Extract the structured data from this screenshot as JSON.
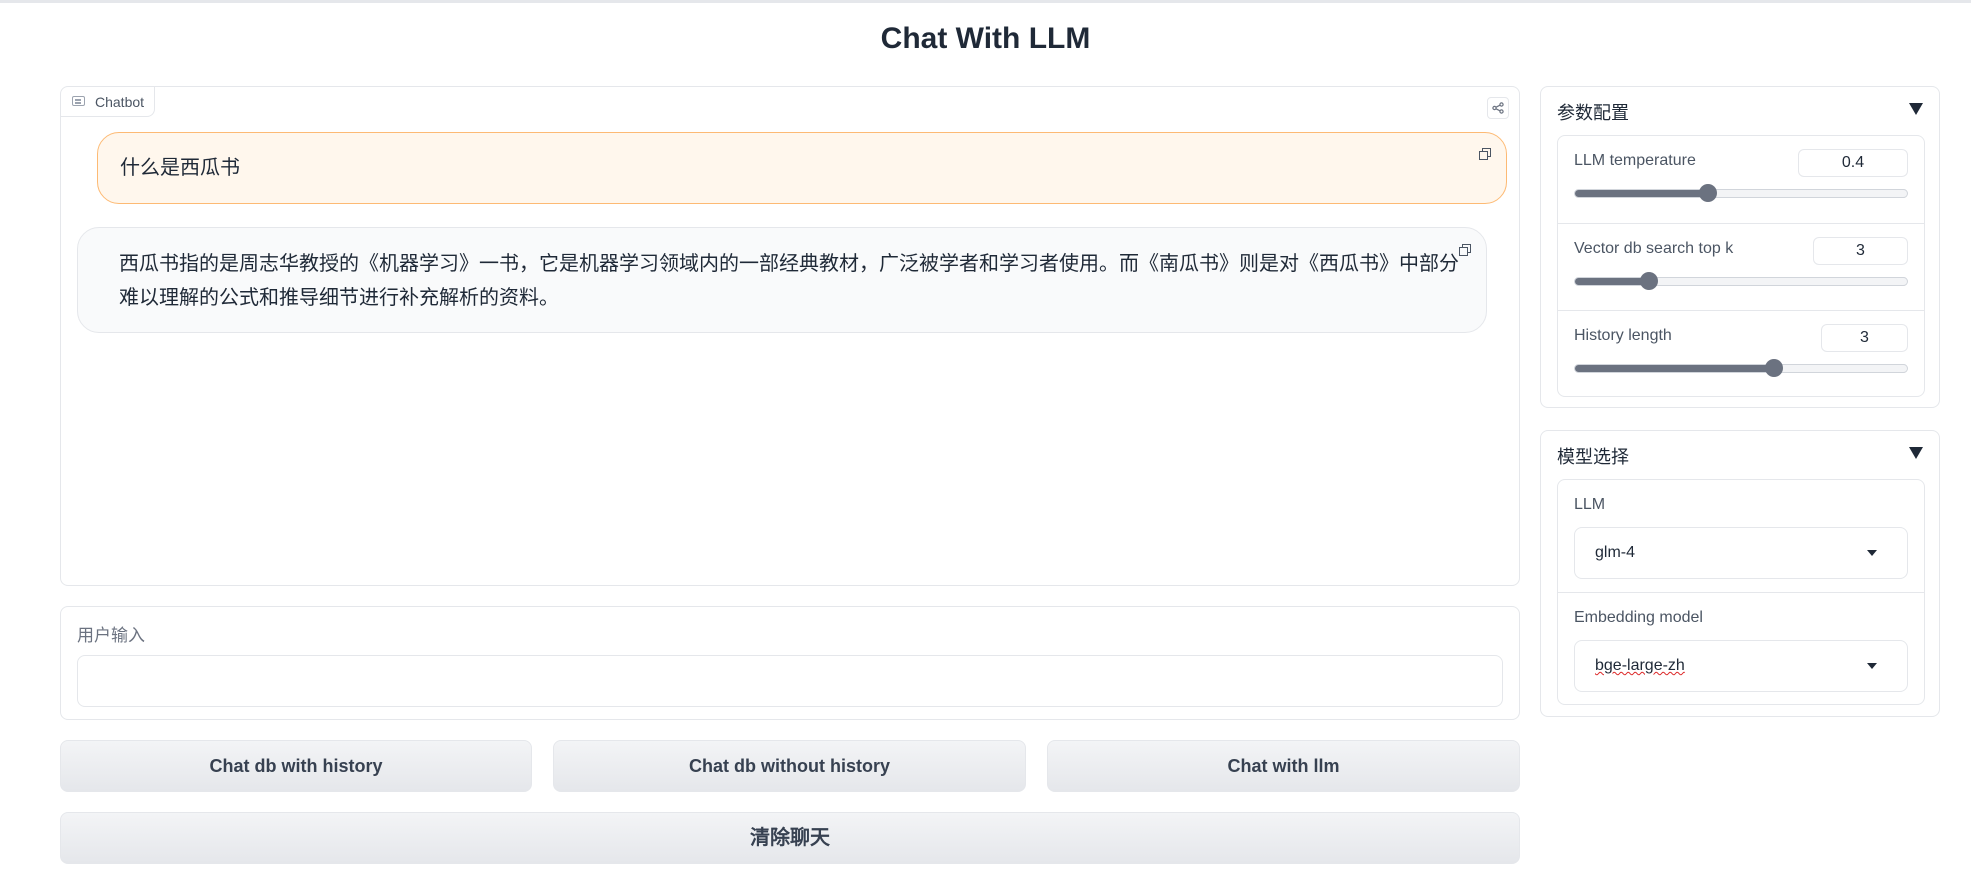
{
  "page_title": "Chat With LLM",
  "chatbot": {
    "label": "Chatbot",
    "messages": [
      {
        "role": "user",
        "text": "什么是西瓜书"
      },
      {
        "role": "bot",
        "text": "西瓜书指的是周志华教授的《机器学习》一书，它是机器学习领域内的一部经典教材，广泛被学者和学习者使用。而《南瓜书》则是对《西瓜书》中部分难以理解的公式和推导细节进行补充解析的资料。"
      }
    ]
  },
  "user_input": {
    "label": "用户输入",
    "value": "",
    "placeholder": ""
  },
  "buttons": {
    "chat_db_history": "Chat db with history",
    "chat_db_no_history": "Chat db without history",
    "chat_llm": "Chat with llm",
    "clear": "清除聊天"
  },
  "params": {
    "title": "参数配置",
    "temperature": {
      "label": "LLM temperature",
      "value": "0.4",
      "fraction": 0.4
    },
    "top_k": {
      "label": "Vector db search top k",
      "value": "3",
      "fraction": 0.222
    },
    "history": {
      "label": "History length",
      "value": "3",
      "fraction": 0.6
    }
  },
  "model": {
    "title": "模型选择",
    "llm": {
      "label": "LLM",
      "value": "glm-4"
    },
    "embedding": {
      "label": "Embedding model",
      "value": "bge-large-zh"
    }
  },
  "colors": {
    "user_bubble": "#fff7ed",
    "user_border": "#fdba74",
    "slider": "#6b7280"
  }
}
